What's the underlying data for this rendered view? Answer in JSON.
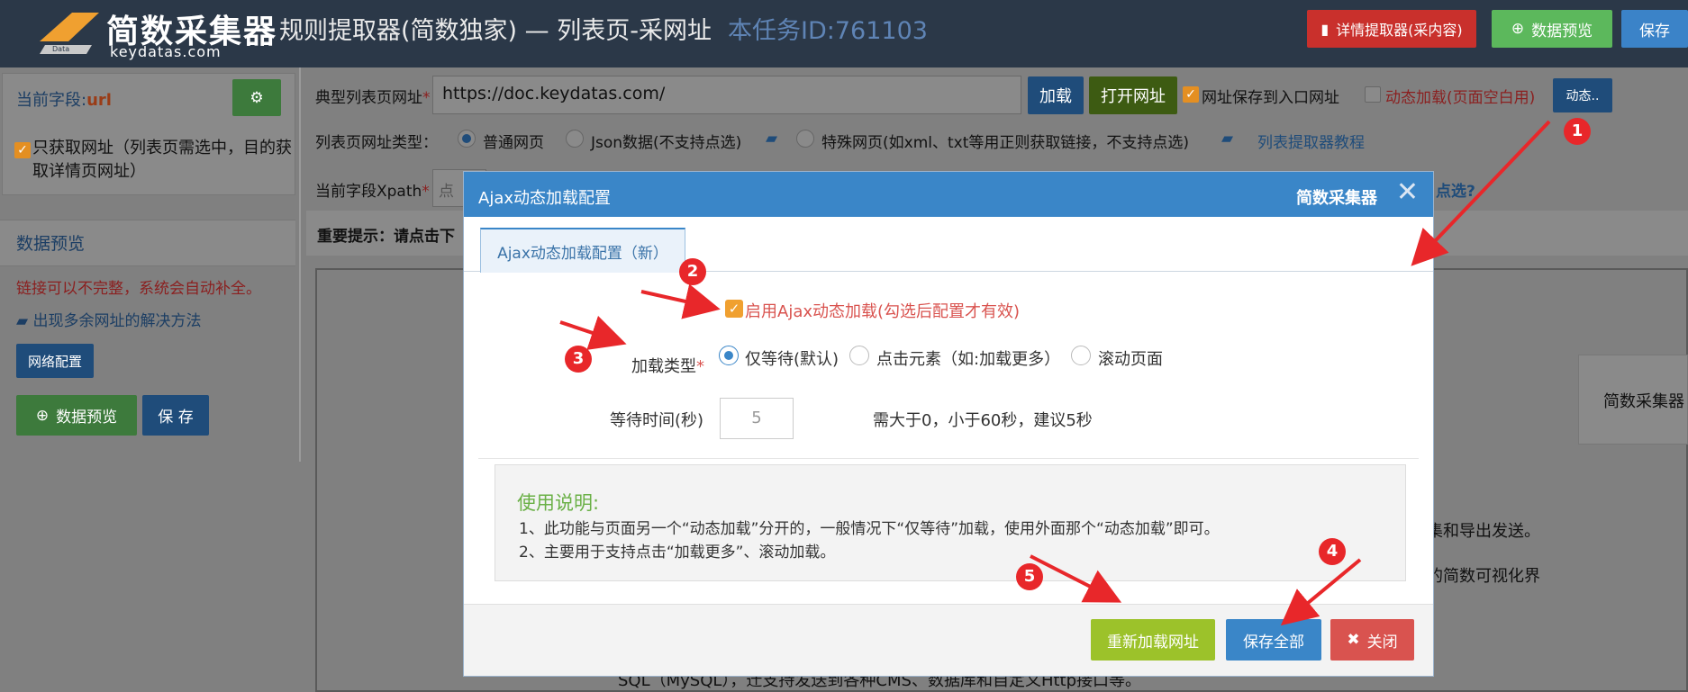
{
  "header": {
    "logo_text": "简数采集器",
    "logo_domain": "keydatas.com",
    "page_title": "规则提取器(简数独家) — 列表页-采网址",
    "task_id": "本任务ID:761103",
    "btn_detail": "详情提取器(采内容)",
    "btn_preview": "数据预览",
    "btn_save": "保存"
  },
  "sidebar": {
    "current_field_label": "当前字段:",
    "current_field_value": "url",
    "only_fetch_text": "只获取网址（列表页需选中，目的获取详情页网址）",
    "preview_title": "数据预览",
    "warn_text": "链接可以不完整，系统会自动补全。",
    "solution_link": "出现多余网址的解决方法",
    "network_btn": "网络配置",
    "preview_btn": "数据预览",
    "save_btn": "保 存"
  },
  "main": {
    "url_label": "典型列表页网址",
    "url_value": "https://doc.keydatas.com/",
    "load_btn": "加载",
    "open_btn": "打开网址",
    "save_to_entry": "网址保存到入口网址",
    "dynamic_load": "动态加载(页面空白用)",
    "dynamic_btn": "动态..",
    "type_label": "列表页网址类型：",
    "type_normal": "普通网页",
    "type_json": "Json数据(不支持点选)",
    "type_special": "特殊网页(如xml、txt等用正则获取链接，不支持点选)",
    "tutorial_link": "列表提取器教程",
    "xpath_label": "当前字段Xpath",
    "xpath_placeholder": "点",
    "xpath_right_text": "点选?",
    "important_hint": "重要提示：请点击下",
    "right_card_text": "简数采集器",
    "bg_text_1": "集和导出发送。",
    "bg_text_2": "的简数可视化界",
    "bg_text_3": "SQL（MySQL），迁支持发送到各种CMS、数据库和自定义Http接口等。"
  },
  "modal": {
    "title": "Ajax动态加载配置",
    "brand": "简数采集器",
    "close_symbol": "✕",
    "tab_label": "Ajax动态加载配置（新）",
    "enable_label": "启用Ajax动态加载(勾选后配置才有效)",
    "load_type_label": "加载类型",
    "load_type_options": [
      "仅等待(默认)",
      "点击元素（如:加载更多）",
      "滚动页面"
    ],
    "wait_label": "等待时间(秒)",
    "wait_value": "5",
    "wait_hint": "需大于0，小于60秒，建议5秒",
    "note_title": "使用说明:",
    "note_line_1": "1、此功能与页面另一个“动态加载”分开的，一般情况下“仅等待”加载，使用外面那个“动态加载”即可。",
    "note_line_2": "2、主要用于支持点击“加载更多”、滚动加载。",
    "btn_reload": "重新加载网址",
    "btn_save_all": "保存全部",
    "btn_close": "关闭"
  },
  "annotations": [
    "1",
    "2",
    "3",
    "4",
    "5"
  ],
  "colors": {
    "header_bg": "#2b3848",
    "modal_header": "#3a86c8",
    "danger": "#d9534f",
    "success_lime": "#9cc22a",
    "annotation_red": "#e8272a",
    "checkbox_orange": "#f0a030"
  },
  "icons": [
    "logo-icon",
    "file-icon",
    "search-icon",
    "gear-icon",
    "book-icon",
    "close-icon",
    "times-icon"
  ]
}
